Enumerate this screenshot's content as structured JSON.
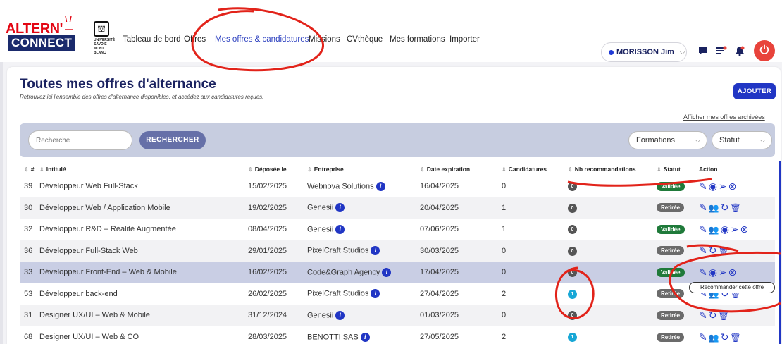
{
  "logo": {
    "line1": "ALTERN'",
    "line2": "CONNECT"
  },
  "university": {
    "crest": "⛫",
    "text": "UNIVERSITÉ SAVOIE MONT BLANC"
  },
  "nav": [
    "Tableau de bord",
    "Offres",
    "Mes offres & candidatures",
    "Missions",
    "CVthèque",
    "Mes formations",
    "Importer"
  ],
  "user": {
    "name": "MORISSON Jim"
  },
  "page": {
    "title": "Toutes mes offres d'alternance",
    "subtitle": "Retrouvez ici l'ensemble des offres d'alternance disponibles, et accédez aux candidatures reçues.",
    "add_button": "AJOUTER",
    "archives_link": "Afficher mes offres archivées"
  },
  "filters": {
    "search_placeholder": "Recherche",
    "search_button": "RECHERCHER",
    "formations": "Formations",
    "statut": "Statut"
  },
  "table": {
    "headers": [
      "#",
      "Intitulé",
      "Déposée le",
      "Entreprise",
      "Date expiration",
      "Candidatures",
      "Nb recommandations",
      "Statut",
      "Action"
    ],
    "rows": [
      {
        "id": "39",
        "title": "Développeur Web Full-Stack",
        "date": "15/02/2025",
        "company": "Webnova Solutions",
        "expiration": "16/04/2025",
        "candidatures": "0",
        "recommendations": "0",
        "status": "Validée"
      },
      {
        "id": "30",
        "title": "Développeur Web / Application Mobile",
        "date": "19/02/2025",
        "company": "Genesii",
        "expiration": "20/04/2025",
        "candidatures": "1",
        "recommendations": "0",
        "status": "Retirée"
      },
      {
        "id": "32",
        "title": "Développeur R&D – Réalité Augmentée",
        "date": "08/04/2025",
        "company": "Genesii",
        "expiration": "07/06/2025",
        "candidatures": "1",
        "recommendations": "0",
        "status": "Validée"
      },
      {
        "id": "36",
        "title": "Développeur Full-Stack Web",
        "date": "29/01/2025",
        "company": "PixelCraft Studios",
        "expiration": "30/03/2025",
        "candidatures": "0",
        "recommendations": "0",
        "status": "Retirée"
      },
      {
        "id": "33",
        "title": "Développeur Front-End – Web & Mobile",
        "date": "16/02/2025",
        "company": "Code&Graph Agency",
        "expiration": "17/04/2025",
        "candidatures": "0",
        "recommendations": "0",
        "status": "Validée"
      },
      {
        "id": "53",
        "title": "Développeur back-end",
        "date": "26/02/2025",
        "company": "PixelCraft Studios",
        "expiration": "27/04/2025",
        "candidatures": "2",
        "recommendations": "1",
        "status": "Retirée"
      },
      {
        "id": "31",
        "title": "Designer UX/UI – Web & Mobile",
        "date": "31/12/2024",
        "company": "Genesii",
        "expiration": "01/03/2025",
        "candidatures": "0",
        "recommendations": "0",
        "status": "Retirée"
      },
      {
        "id": "68",
        "title": "Designer UX/UI – Web & CO",
        "date": "28/03/2025",
        "company": "BENOTTI SAS",
        "expiration": "27/05/2025",
        "candidatures": "2",
        "recommendations": "1",
        "status": "Retirée"
      }
    ]
  },
  "tooltip": "Recommander cette offre",
  "colors": {
    "primary": "#2136c4",
    "navy": "#1a2260",
    "validated": "#1f7a3a",
    "retired": "#6b6b6b",
    "badge_zero": "#555555",
    "badge_positive": "#18a7d6",
    "annotation": "#e2231a"
  }
}
